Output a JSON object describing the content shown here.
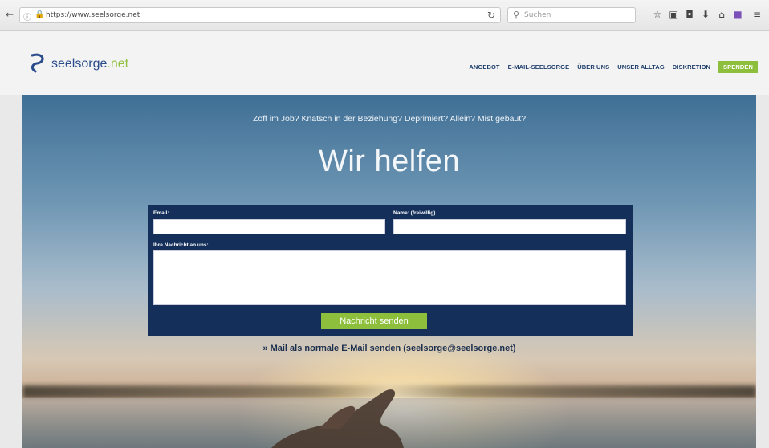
{
  "browser": {
    "url": "https://www.seelsorge.net",
    "search_placeholder": "Suchen",
    "back_glyph": "←",
    "reload_glyph": "↻"
  },
  "site": {
    "logo_name": "seelsorge",
    "logo_tld": ".net",
    "nav": [
      "ANGEBOT",
      "E-MAIL-SEELSORGE",
      "ÜBER UNS",
      "UNSER ALLTAG",
      "DISKRETION"
    ],
    "cta": "SPENDEN",
    "colors": {
      "brand_blue": "#1d3d6b",
      "accent_green": "#8dbf3c",
      "form_bg": "#14305a"
    }
  },
  "hero": {
    "tagline": "Zoff im Job? Knatsch in der Beziehung? Deprimiert? Allein? Mist gebaut?",
    "title": "Wir helfen"
  },
  "form": {
    "email_label": "Email:",
    "email_value": "",
    "name_label": "Name: (freiwillig)",
    "name_value": "",
    "message_label": "Ihre Nachricht an uns:",
    "message_value": "",
    "submit_label": "Nachricht senden"
  },
  "mail_alt": "» Mail als normale E-Mail senden (seelsorge@seelsorge.net)"
}
